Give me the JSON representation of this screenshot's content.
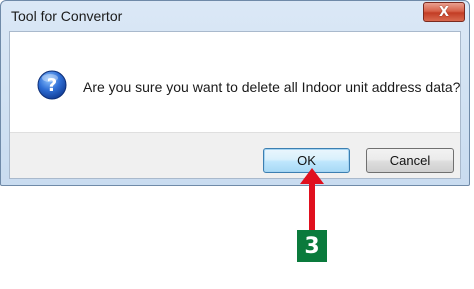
{
  "window": {
    "title": "Tool for Convertor",
    "close_label": "X"
  },
  "dialog": {
    "message": "Are you sure you want to delete all Indoor unit address data?",
    "icon": "question-icon"
  },
  "buttons": {
    "ok_label": "OK",
    "cancel_label": "Cancel"
  },
  "annotation": {
    "step_number": "3",
    "arrow_color": "#e0101e",
    "badge_color": "#0a7a3c"
  }
}
